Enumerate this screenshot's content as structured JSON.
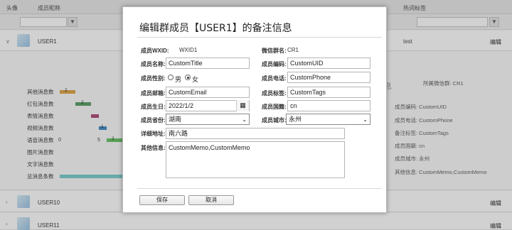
{
  "background": {
    "columns": {
      "avatar": "头像",
      "nickname": "成员昵称",
      "hot_tags": "热词标签"
    },
    "filter_icon": "▼",
    "rows": [
      {
        "expander": "∨",
        "name": "USER1",
        "tag": "test",
        "edit": "编辑"
      },
      {
        "expander": "›",
        "name": "USER10",
        "edit": "编辑"
      },
      {
        "expander": "›",
        "name": "USER11",
        "edit": "编辑"
      }
    ],
    "chart": {
      "labels": [
        "其他消息数",
        "红包消息数",
        "表情消息数",
        "视频消息数",
        "语音消息数",
        "图片消息数",
        "文字消息数",
        "总消息条数"
      ],
      "bar_values": [
        "2",
        "2",
        "",
        "1",
        "2",
        "",
        "",
        ""
      ],
      "axis": [
        "0",
        "5"
      ]
    },
    "side": {
      "heading": "息",
      "group": "所属微信群: CR1",
      "lines": [
        "成员编码: CustomUID",
        "成员电话: CustomPhone",
        "备注标签: CustomTags",
        "成员国籍: cn",
        "成员城市: 永州",
        "其他信息: CustomMemo,CustomMemo"
      ]
    }
  },
  "modal": {
    "title": "编辑群成员【USER1】的备注信息",
    "wxid_label": "成员WXID:",
    "wxid_value": "WXID1",
    "group_label": "微信群名:",
    "group_value": "CR1",
    "name_label": "成员名称:",
    "name_value": "CustomTitle",
    "uid_label": "成员编码:",
    "uid_value": "CustomUID",
    "gender_label": "成员性别:",
    "gender_male": "男",
    "gender_female": "女",
    "gender_selected": "女",
    "phone_label": "成员电话:",
    "phone_value": "CustomPhone",
    "email_label": "成员邮箱:",
    "email_value": "CustomEmail",
    "tags_label": "成员标签:",
    "tags_value": "CustomTags",
    "birthday_label": "成员生日:",
    "birthday_value": "2022/1/2",
    "nation_label": "成员国籍:",
    "nation_value": "cn",
    "province_label": "成员省份:",
    "province_value": "湖南",
    "city_label": "成员城市:",
    "city_value": "永州",
    "address_label": "详细地址:",
    "address_value": "南六路",
    "other_label": "其他信息:",
    "other_value": "CustomMemo,CustomMemo",
    "save_label": "保存",
    "cancel_label": "取消",
    "calendar_icon": "▦",
    "dropdown_icon": "⌄"
  }
}
